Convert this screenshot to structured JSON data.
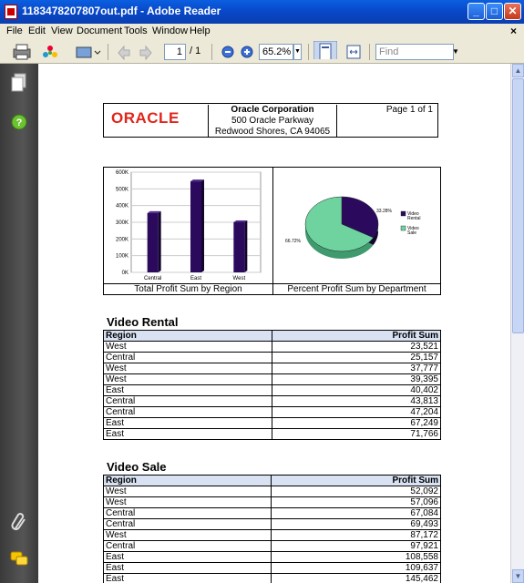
{
  "window": {
    "title": "1183478207807out.pdf - Adobe Reader",
    "controls": {
      "minimize": "_",
      "maximize": "□",
      "close": "✕"
    }
  },
  "menu": {
    "items": [
      "File",
      "Edit",
      "View",
      "Document",
      "Tools",
      "Window",
      "Help"
    ],
    "close": "×"
  },
  "toolbar": {
    "page_current": "1",
    "page_total": "/ 1",
    "zoom": "65.2%",
    "find_placeholder": "Find"
  },
  "header": {
    "logo_text": "ORACLE",
    "company": "Oracle Corporation",
    "address1": "500 Oracle Parkway",
    "address2": "Redwood Shores, CA 94065",
    "page": "Page 1 of 1"
  },
  "charts": {
    "bar_caption": "Total Profit Sum by Region",
    "pie_caption": "Percent Profit Sum by Department"
  },
  "chart_data": [
    {
      "type": "bar",
      "categories": [
        "Central",
        "East",
        "West"
      ],
      "values": [
        355000,
        545000,
        300000
      ],
      "ylim": [
        0,
        600000
      ],
      "yticks": [
        "0K",
        "100K",
        "200K",
        "300K",
        "400K",
        "500K",
        "600K"
      ],
      "color": "#2B0A5E"
    },
    {
      "type": "pie",
      "series": [
        {
          "name": "Video Rental",
          "value": 33.28,
          "label": "33.28%",
          "color": "#2B0A5E"
        },
        {
          "name": "Video Sale",
          "value": 66.72,
          "label": "66.72%",
          "color": "#6FD3A0"
        }
      ],
      "legend": [
        "Video Rental",
        "Video Sale"
      ]
    }
  ],
  "sections": [
    {
      "title": "Video Rental",
      "columns": [
        "Region",
        "Profit Sum"
      ],
      "rows": [
        [
          "West",
          "23,521"
        ],
        [
          "Central",
          "25,157"
        ],
        [
          "West",
          "37,777"
        ],
        [
          "West",
          "39,395"
        ],
        [
          "East",
          "40,402"
        ],
        [
          "Central",
          "43,813"
        ],
        [
          "Central",
          "47,204"
        ],
        [
          "East",
          "67,249"
        ],
        [
          "East",
          "71,766"
        ]
      ]
    },
    {
      "title": "Video Sale",
      "columns": [
        "Region",
        "Profit Sum"
      ],
      "rows": [
        [
          "West",
          "52,092"
        ],
        [
          "West",
          "57,096"
        ],
        [
          "Central",
          "67,084"
        ],
        [
          "Central",
          "69,493"
        ],
        [
          "West",
          "87,172"
        ],
        [
          "Central",
          "97,921"
        ],
        [
          "East",
          "108,558"
        ],
        [
          "East",
          "109,637"
        ],
        [
          "East",
          "145,462"
        ]
      ]
    }
  ]
}
